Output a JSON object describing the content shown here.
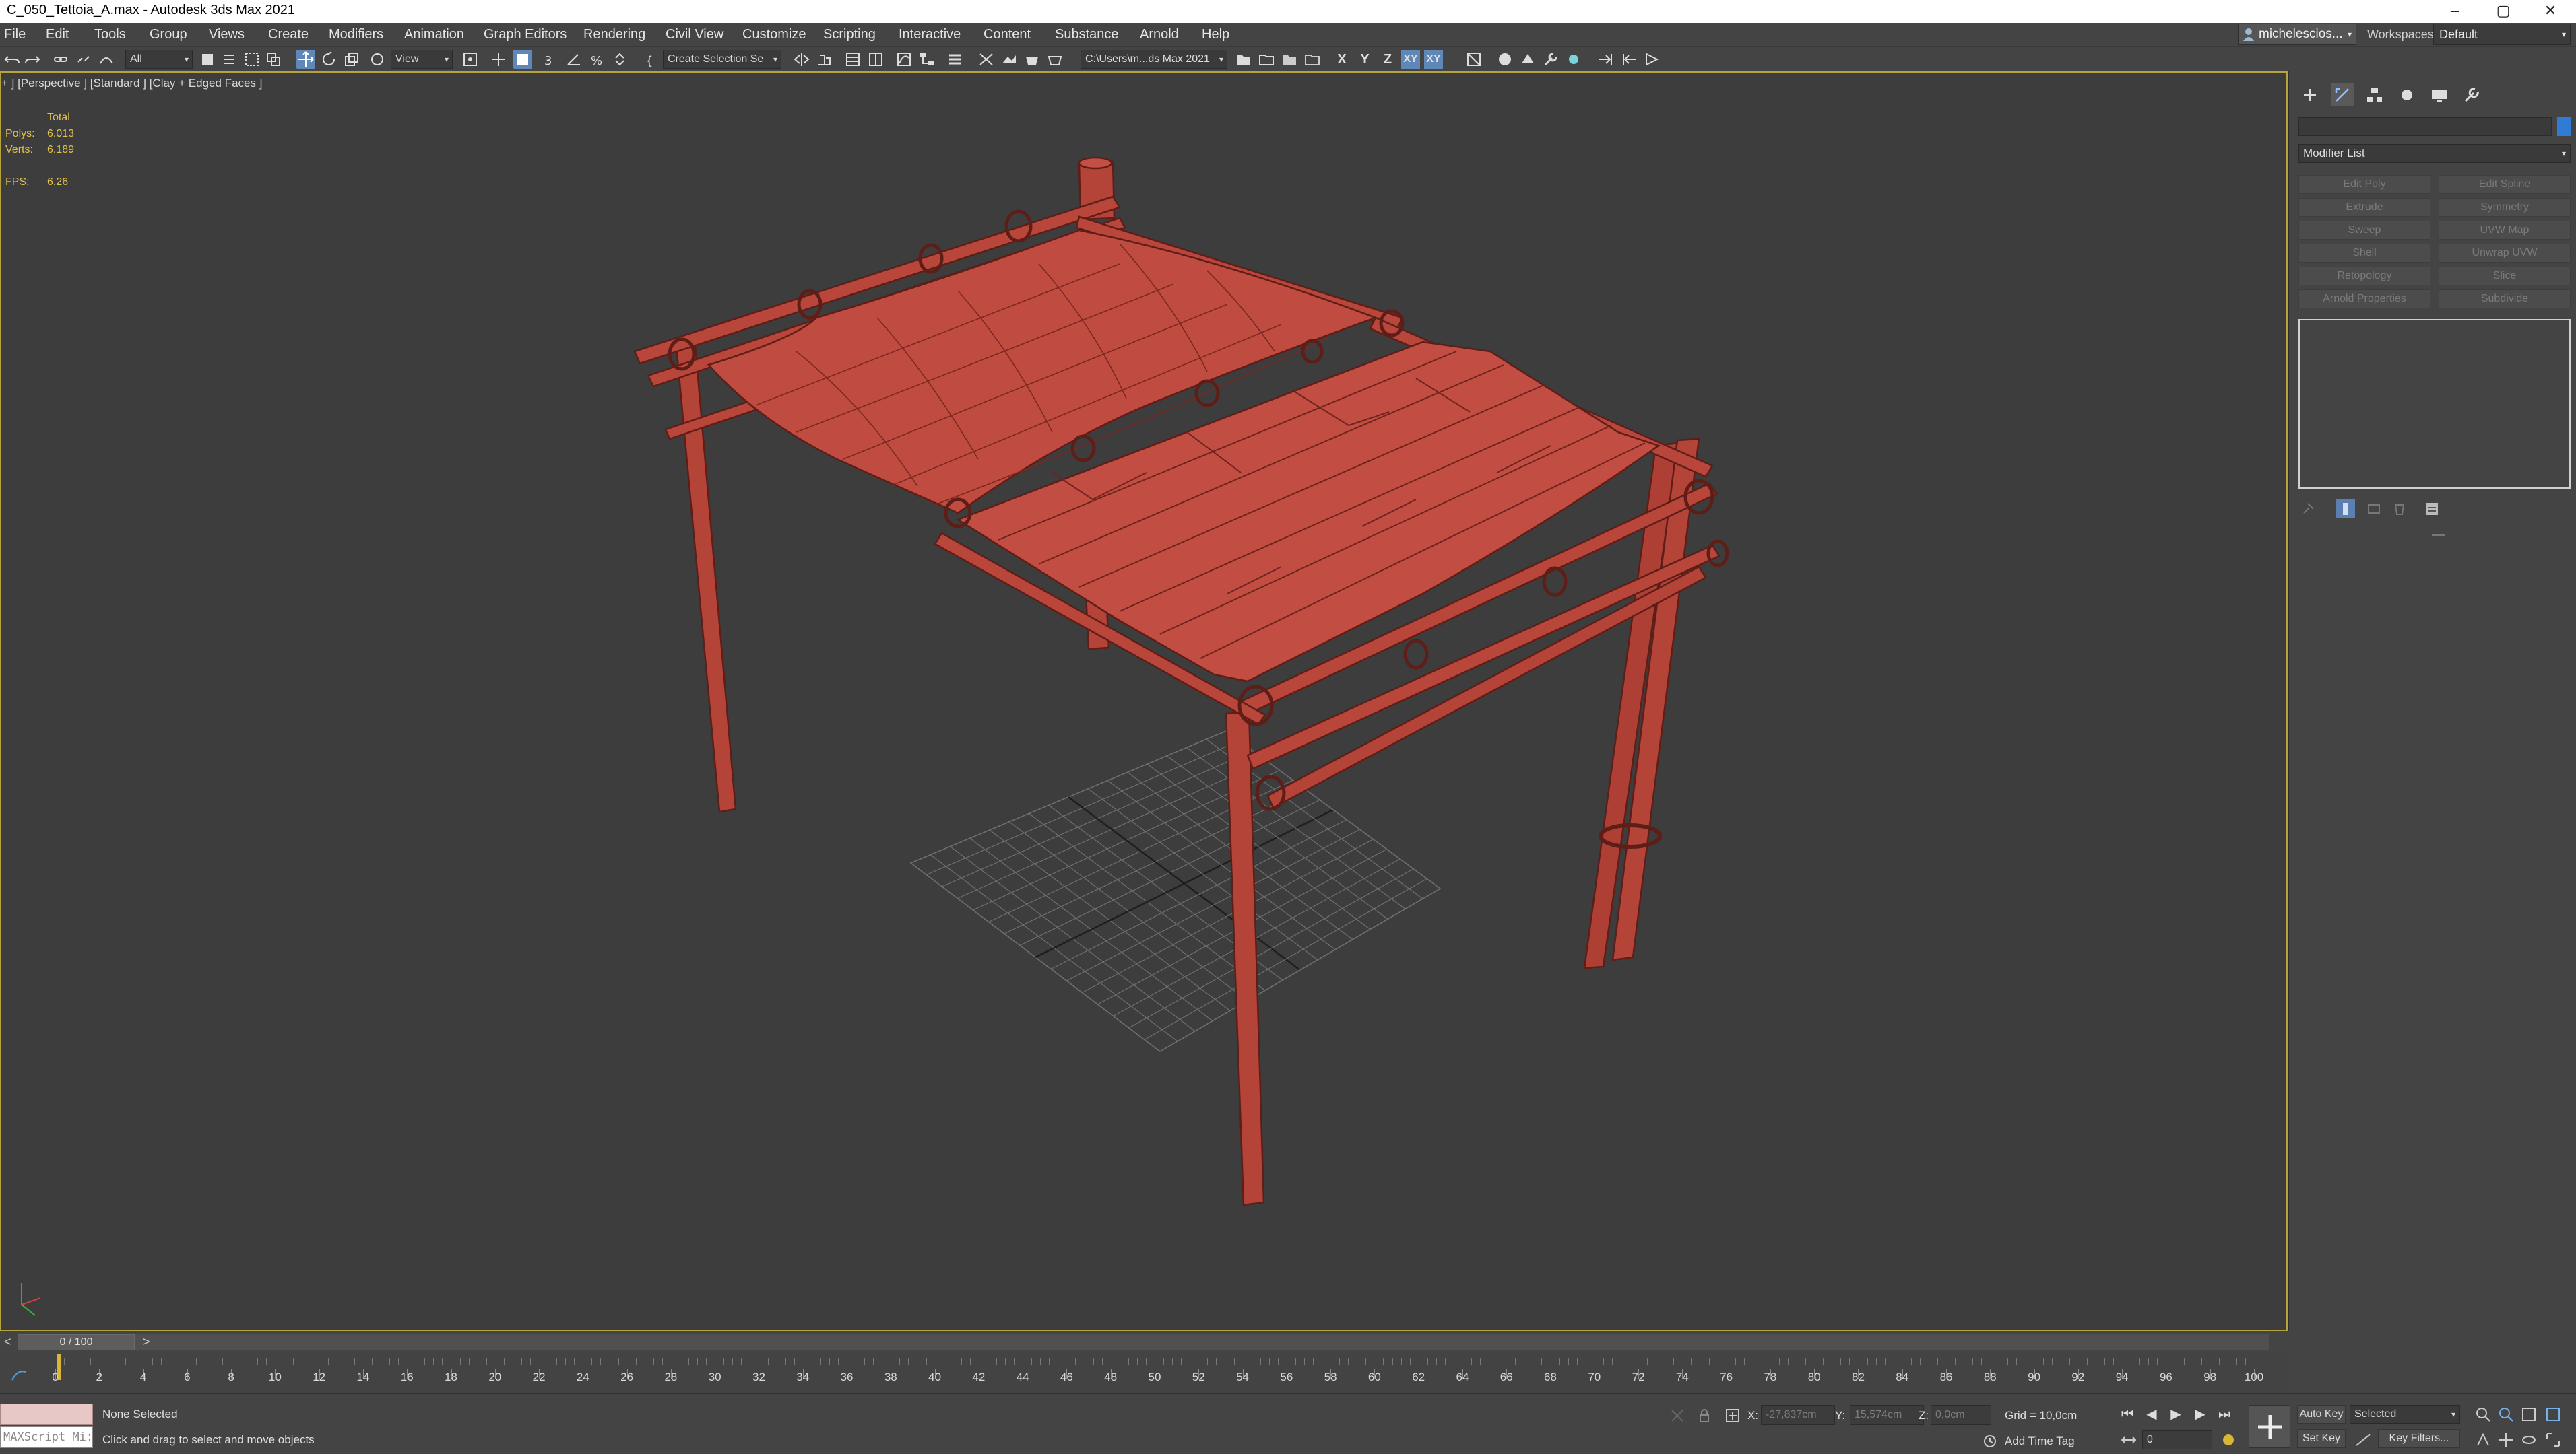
{
  "window": {
    "title": "C_050_Tettoia_A.max - Autodesk 3ds Max 2021",
    "controls": [
      "–",
      "▢",
      "✕"
    ]
  },
  "menu": [
    "File",
    "Edit",
    "Tools",
    "Group",
    "Views",
    "Create",
    "Modifiers",
    "Animation",
    "Graph Editors",
    "Rendering",
    "Civil View",
    "Customize",
    "Scripting",
    "Interactive",
    "Content",
    "Substance",
    "Arnold",
    "Help"
  ],
  "account": {
    "user": "michelescios...",
    "workspaces_label": "Workspaces:",
    "workspace": "Default"
  },
  "toolbar": {
    "filter": "All",
    "ref_coord": "View",
    "selection_set": "Create Selection Se",
    "project_path": "C:\\Users\\m...ds Max 2021",
    "axes": [
      "X",
      "Y",
      "Z",
      "XY",
      "XY"
    ]
  },
  "viewport": {
    "label": "+ ] [Perspective ] [Standard ] [Clay + Edged Faces ]",
    "stats": {
      "total_label": "Total",
      "polys_label": "Polys:",
      "polys": "6.013",
      "verts_label": "Verts:",
      "verts": "6.189",
      "fps_label": "FPS:",
      "fps": "6,26"
    },
    "model_color": "#b9473c"
  },
  "command_panel": {
    "modifier_list": "Modifier List",
    "modifiers": [
      "Edit Poly",
      "Edit Spline",
      "Extrude",
      "Symmetry",
      "Sweep",
      "UVW Map",
      "Shell",
      "Unwrap UVW",
      "Retopology",
      "Slice",
      "Arnold Properties",
      "Subdivide"
    ],
    "object_color": "#2f7bd6"
  },
  "timeline": {
    "slider": "0 / 100",
    "prev": "<",
    "next": ">",
    "ticks": [
      "0",
      "2",
      "4",
      "6",
      "8",
      "10",
      "12",
      "14",
      "16",
      "18",
      "20",
      "22",
      "24",
      "26",
      "28",
      "30",
      "32",
      "34",
      "36",
      "38",
      "40",
      "42",
      "44",
      "46",
      "48",
      "50",
      "52",
      "54",
      "56",
      "58",
      "60",
      "62",
      "64",
      "66",
      "68",
      "70",
      "72",
      "74",
      "76",
      "78",
      "80",
      "82",
      "84",
      "86",
      "88",
      "90",
      "92",
      "94",
      "96",
      "98",
      "100"
    ]
  },
  "status": {
    "maxscript": "MAXScript Mi:",
    "selection": "None Selected",
    "prompt": "Click and drag to select and move objects",
    "x_label": "X:",
    "x": "-27,837cm",
    "y_label": "Y:",
    "y": "15,574cm",
    "z_label": "Z:",
    "z": "0,0cm",
    "grid": "Grid = 10,0cm",
    "add_time_tag": "Add Time Tag",
    "auto_key": "Auto Key",
    "set_key": "Set Key",
    "key_mode": "Selected",
    "key_filters": "Key Filters...",
    "frame": "0"
  }
}
